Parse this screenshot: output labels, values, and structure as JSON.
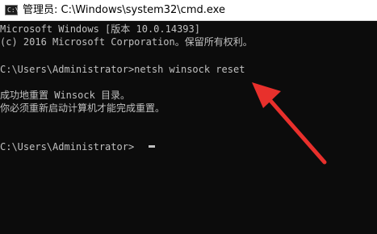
{
  "window": {
    "title": "管理员: C:\\Windows\\system32\\cmd.exe",
    "icon": "console-icon",
    "icon_glyph": "C:\\"
  },
  "console": {
    "lines": [
      "Microsoft Windows [版本 10.0.14393]",
      "(c) 2016 Microsoft Corporation。保留所有权利。",
      "",
      "C:\\Users\\Administrator>netsh winsock reset",
      "",
      "成功地重置 Winsock 目录。",
      "你必须重新启动计算机才能完成重置。",
      "",
      "",
      "C:\\Users\\Administrator>"
    ]
  },
  "annotation": {
    "arrow_color": "#e8302c"
  },
  "colors": {
    "console_bg": "#0c0c0c",
    "console_text": "#c0c0c0",
    "titlebar_bg": "#ffffff"
  }
}
